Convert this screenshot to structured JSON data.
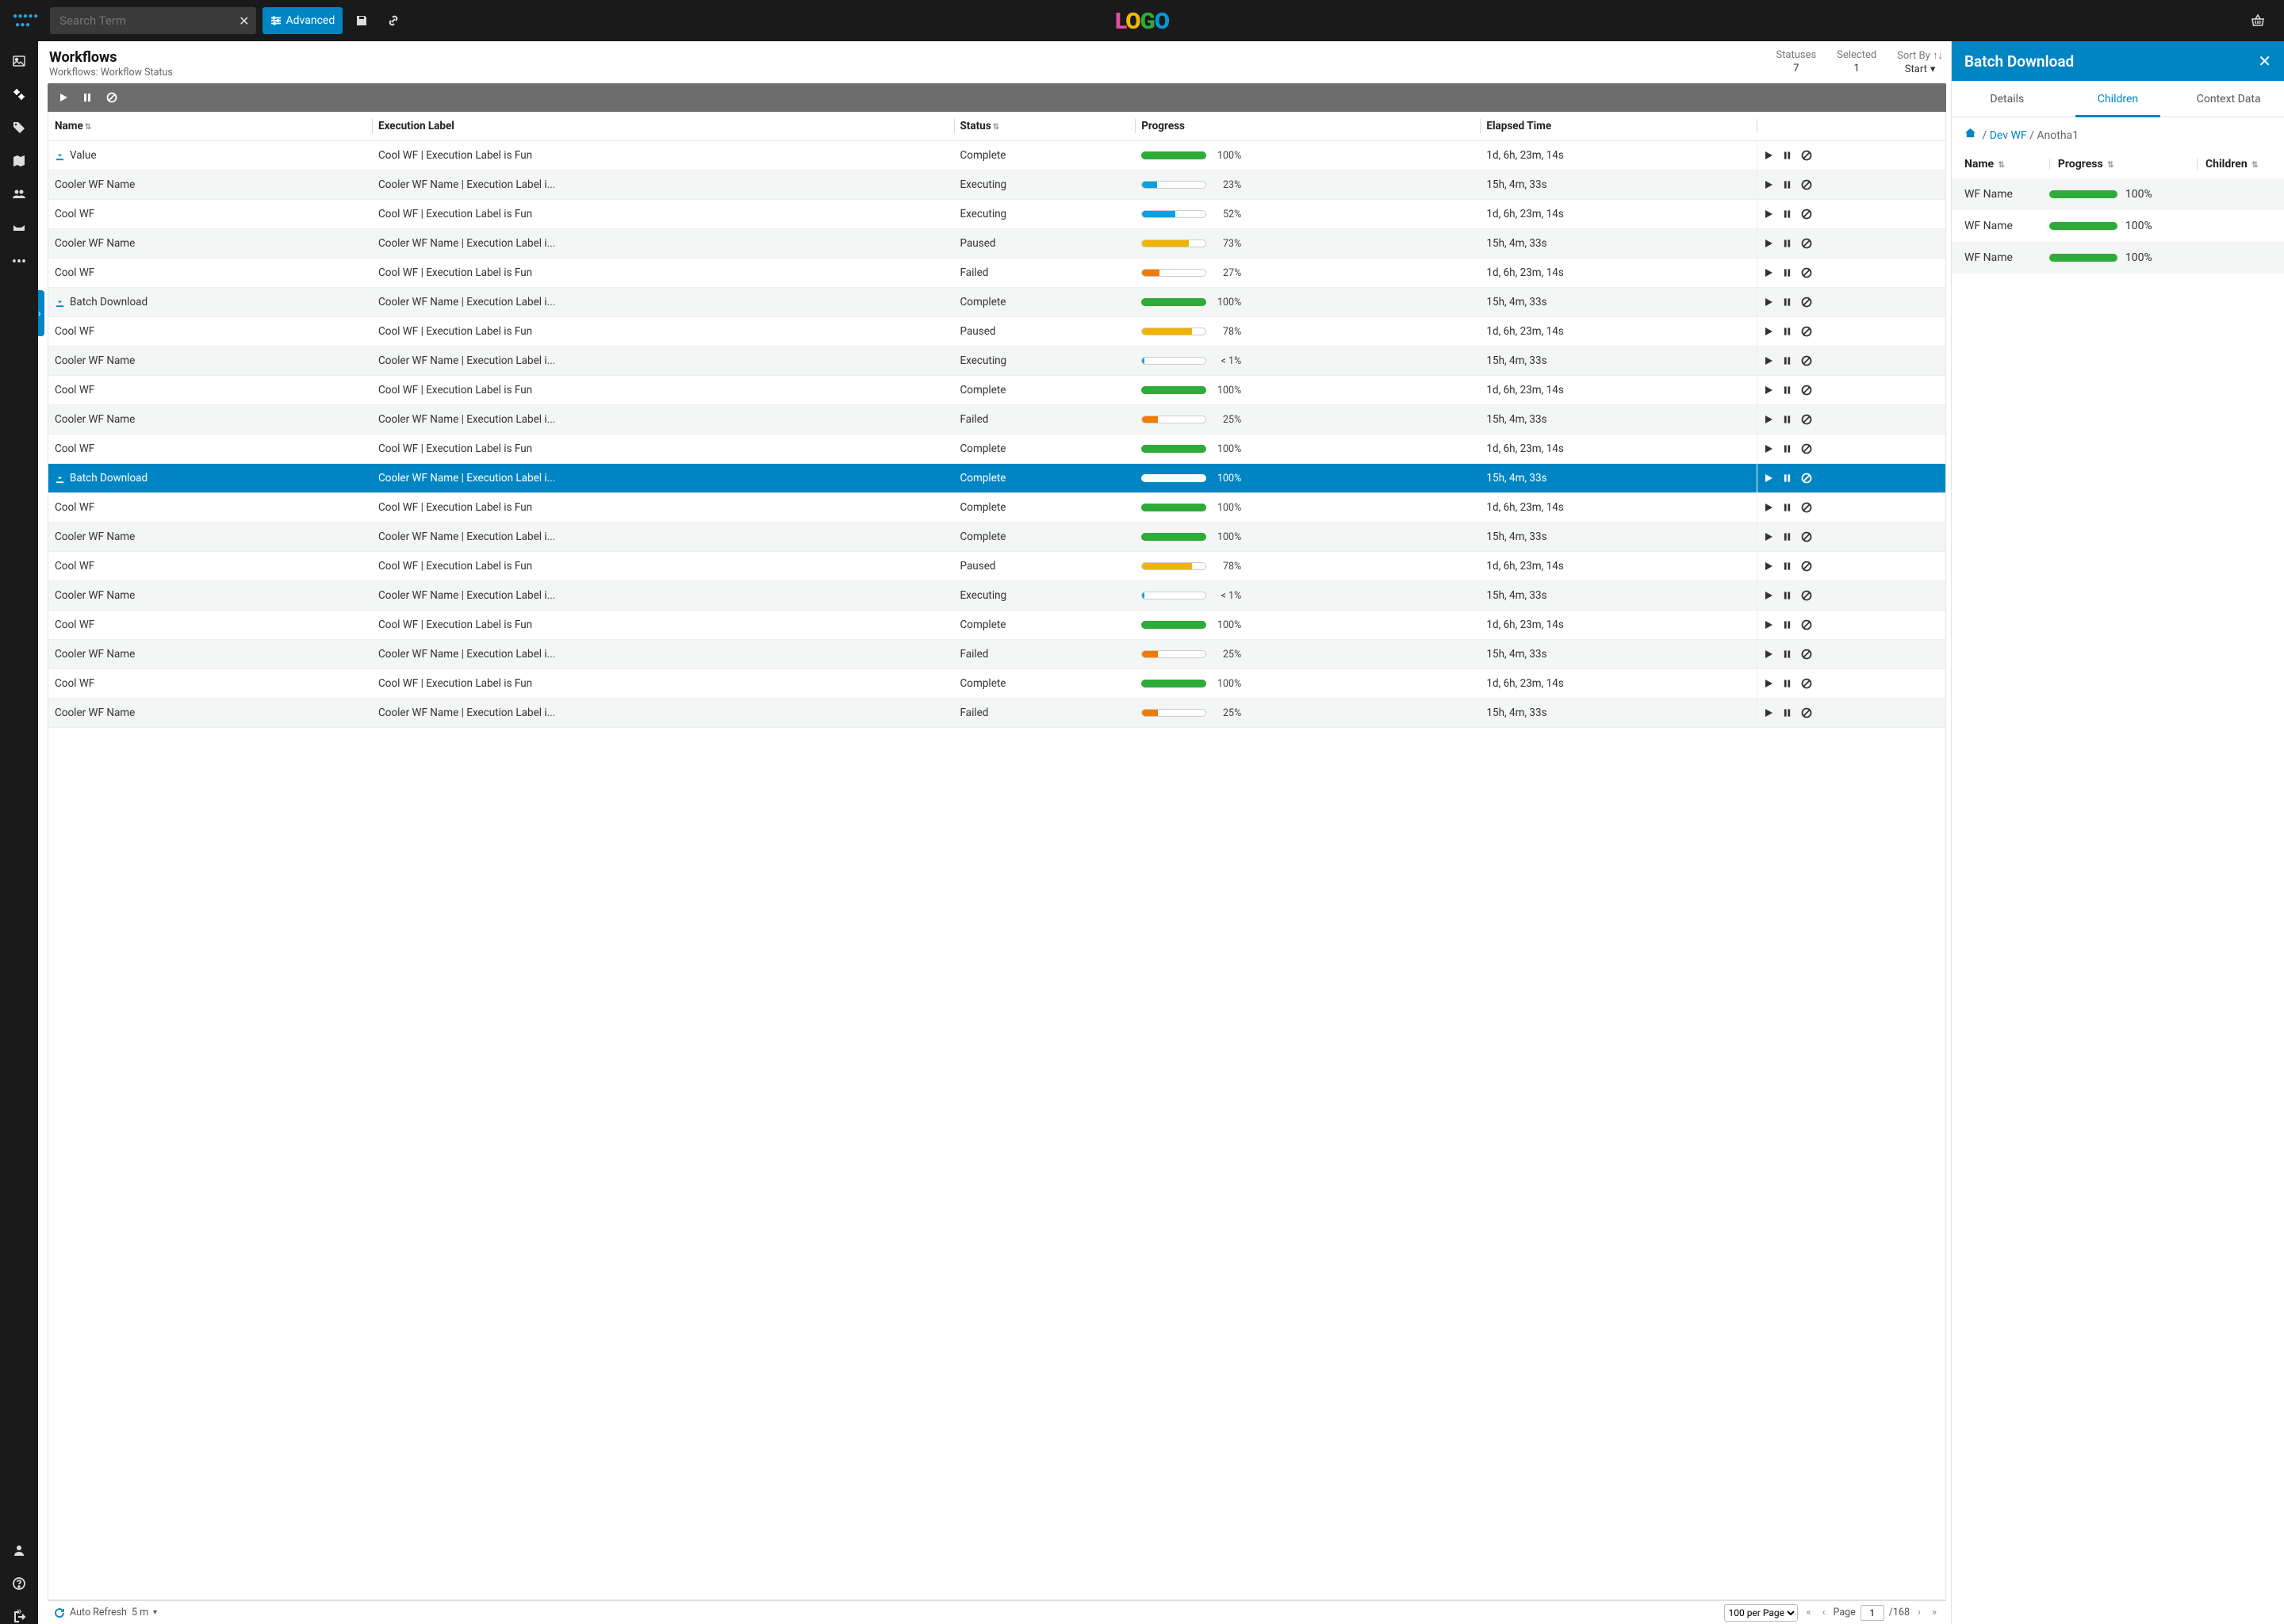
{
  "search": {
    "placeholder": "Search Term",
    "advanced_label": "Advanced"
  },
  "page": {
    "title": "Workflows",
    "subtitle": "Workflows: Workflow Status"
  },
  "summary": {
    "statuses": {
      "label": "Statuses",
      "value": "7"
    },
    "selected": {
      "label": "Selected",
      "value": "1"
    },
    "sort": {
      "label": "Sort By",
      "value": "Start"
    }
  },
  "columns": {
    "name": "Name",
    "exec": "Execution Label",
    "status": "Status",
    "progress": "Progress",
    "elapsed": "Elapsed Time"
  },
  "rows": [
    {
      "dl": true,
      "name": "Value",
      "exec": "Cool WF | Execution Label is Fun",
      "status": "Complete",
      "progress": 100,
      "pct": "100%",
      "color": "#2fab3a",
      "outlined": false,
      "elapsed": "1d, 6h, 23m, 14s",
      "sel": false
    },
    {
      "dl": false,
      "name": "Cooler WF Name",
      "exec": "Cooler WF Name | Execution Label i...",
      "status": "Executing",
      "progress": 23,
      "pct": "23%",
      "color": "#00a3e0",
      "outlined": true,
      "elapsed": "15h, 4m, 33s",
      "sel": false
    },
    {
      "dl": false,
      "name": "Cool WF",
      "exec": "Cool WF | Execution Label is Fun",
      "status": "Executing",
      "progress": 52,
      "pct": "52%",
      "color": "#00a3e0",
      "outlined": true,
      "elapsed": "1d, 6h, 23m, 14s",
      "sel": false
    },
    {
      "dl": false,
      "name": "Cooler WF Name",
      "exec": "Cooler WF Name | Execution Label i...",
      "status": "Paused",
      "progress": 73,
      "pct": "73%",
      "color": "#f0b400",
      "outlined": true,
      "elapsed": "15h, 4m, 33s",
      "sel": false
    },
    {
      "dl": false,
      "name": "Cool WF",
      "exec": "Cool WF | Execution Label is Fun",
      "status": "Failed",
      "progress": 27,
      "pct": "27%",
      "color": "#f07b00",
      "outlined": true,
      "elapsed": "1d, 6h, 23m, 14s",
      "sel": false
    },
    {
      "dl": true,
      "name": "Batch Download",
      "exec": "Cooler WF Name | Execution Label i...",
      "status": "Complete",
      "progress": 100,
      "pct": "100%",
      "color": "#2fab3a",
      "outlined": false,
      "elapsed": "15h, 4m, 33s",
      "sel": false
    },
    {
      "dl": false,
      "name": "Cool WF",
      "exec": "Cool WF | Execution Label is Fun",
      "status": "Paused",
      "progress": 78,
      "pct": "78%",
      "color": "#f0b400",
      "outlined": true,
      "elapsed": "1d, 6h, 23m, 14s",
      "sel": false
    },
    {
      "dl": false,
      "name": "Cooler WF Name",
      "exec": "Cooler WF Name | Execution Label i...",
      "status": "Executing",
      "progress": 1,
      "pct": "< 1%",
      "color": "#00a3e0",
      "outlined": true,
      "elapsed": "15h, 4m, 33s",
      "sel": false
    },
    {
      "dl": false,
      "name": "Cool WF",
      "exec": "Cool WF | Execution Label is Fun",
      "status": "Complete",
      "progress": 100,
      "pct": "100%",
      "color": "#2fab3a",
      "outlined": false,
      "elapsed": "1d, 6h, 23m, 14s",
      "sel": false
    },
    {
      "dl": false,
      "name": "Cooler WF Name",
      "exec": "Cooler WF Name | Execution Label i...",
      "status": "Failed",
      "progress": 25,
      "pct": "25%",
      "color": "#f07b00",
      "outlined": true,
      "elapsed": "15h, 4m, 33s",
      "sel": false
    },
    {
      "dl": false,
      "name": "Cool WF",
      "exec": "Cool WF | Execution Label is Fun",
      "status": "Complete",
      "progress": 100,
      "pct": "100%",
      "color": "#2fab3a",
      "outlined": false,
      "elapsed": "1d, 6h, 23m, 14s",
      "sel": false
    },
    {
      "dl": true,
      "name": "Batch Download",
      "exec": "Cooler WF Name | Execution Label i...",
      "status": "Complete",
      "progress": 100,
      "pct": "100%",
      "color": "#ffffff",
      "outlined": false,
      "elapsed": "15h, 4m, 33s",
      "sel": true
    },
    {
      "dl": false,
      "name": "Cool WF",
      "exec": "Cool WF | Execution Label is Fun",
      "status": "Complete",
      "progress": 100,
      "pct": "100%",
      "color": "#2fab3a",
      "outlined": false,
      "elapsed": "1d, 6h, 23m, 14s",
      "sel": false
    },
    {
      "dl": false,
      "name": "Cooler WF Name",
      "exec": "Cooler WF Name | Execution Label i...",
      "status": "Complete",
      "progress": 100,
      "pct": "100%",
      "color": "#2fab3a",
      "outlined": false,
      "elapsed": "15h, 4m, 33s",
      "sel": false
    },
    {
      "dl": false,
      "name": "Cool WF",
      "exec": "Cool WF | Execution Label is Fun",
      "status": "Paused",
      "progress": 78,
      "pct": "78%",
      "color": "#f0b400",
      "outlined": true,
      "elapsed": "1d, 6h, 23m, 14s",
      "sel": false
    },
    {
      "dl": false,
      "name": "Cooler WF Name",
      "exec": "Cooler WF Name | Execution Label i...",
      "status": "Executing",
      "progress": 1,
      "pct": "< 1%",
      "color": "#00a3e0",
      "outlined": true,
      "elapsed": "15h, 4m, 33s",
      "sel": false
    },
    {
      "dl": false,
      "name": "Cool WF",
      "exec": "Cool WF | Execution Label is Fun",
      "status": "Complete",
      "progress": 100,
      "pct": "100%",
      "color": "#2fab3a",
      "outlined": false,
      "elapsed": "1d, 6h, 23m, 14s",
      "sel": false
    },
    {
      "dl": false,
      "name": "Cooler WF Name",
      "exec": "Cooler WF Name | Execution Label i...",
      "status": "Failed",
      "progress": 25,
      "pct": "25%",
      "color": "#f07b00",
      "outlined": true,
      "elapsed": "15h, 4m, 33s",
      "sel": false
    },
    {
      "dl": false,
      "name": "Cool WF",
      "exec": "Cool WF | Execution Label is Fun",
      "status": "Complete",
      "progress": 100,
      "pct": "100%",
      "color": "#2fab3a",
      "outlined": false,
      "elapsed": "1d, 6h, 23m, 14s",
      "sel": false
    },
    {
      "dl": false,
      "name": "Cooler WF Name",
      "exec": "Cooler WF Name | Execution Label i...",
      "status": "Failed",
      "progress": 25,
      "pct": "25%",
      "color": "#f07b00",
      "outlined": true,
      "elapsed": "15h, 4m, 33s",
      "sel": false
    }
  ],
  "footer": {
    "autorefresh_label": "Auto Refresh",
    "autorefresh_val": "5 m",
    "per_page": "100 per Page",
    "page_label": "Page",
    "page_value": "1",
    "page_total": "/168"
  },
  "right": {
    "title": "Batch Download",
    "tabs": {
      "details": "Details",
      "children": "Children",
      "context": "Context Data"
    },
    "crumb": {
      "a": " Dev WF ",
      "b": "Anotha1"
    },
    "cols": {
      "name": "Name",
      "progress": "Progress",
      "children": "Children"
    },
    "rows": [
      {
        "name": "WF Name",
        "pct": "100%"
      },
      {
        "name": "WF Name",
        "pct": "100%"
      },
      {
        "name": "WF Name",
        "pct": "100%"
      }
    ]
  },
  "logo": {
    "l": "L",
    "o1": "O",
    "g": "G",
    "o2": "O"
  }
}
